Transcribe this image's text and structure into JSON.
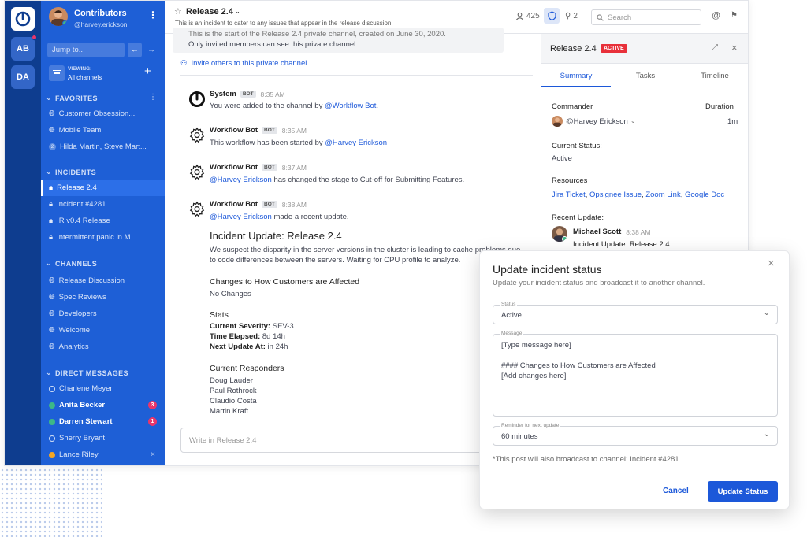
{
  "teams": {
    "items": [
      {
        "initials": "AB"
      },
      {
        "initials": "DA"
      }
    ]
  },
  "sidebar": {
    "team_name": "Contributors",
    "username": "@harvey.erickson",
    "jump_placeholder": "Jump to...",
    "viewing_label": "VIEWING:",
    "viewing_value": "All channels",
    "favorites_header": "FAVORITES",
    "favorites": [
      {
        "label": "Customer Obsession..."
      },
      {
        "label": "Mobile Team"
      },
      {
        "label": "Hilda Martin, Steve Mart...",
        "count": "2"
      }
    ],
    "incidents_header": "INCIDENTS",
    "incidents": [
      {
        "label": "Release 2.4"
      },
      {
        "label": "Incident #4281"
      },
      {
        "label": "IR v0.4 Release"
      },
      {
        "label": "Intermittent panic in M..."
      }
    ],
    "channels_header": "CHANNELS",
    "channels": [
      {
        "label": "Release Discussion"
      },
      {
        "label": "Spec Reviews"
      },
      {
        "label": "Developers"
      },
      {
        "label": "Welcome"
      },
      {
        "label": "Analytics"
      }
    ],
    "dm_header": "DIRECT MESSAGES",
    "dms": [
      {
        "label": "Charlene Meyer"
      },
      {
        "label": "Anita Becker",
        "badge": "3"
      },
      {
        "label": "Darren Stewart",
        "badge": "1"
      },
      {
        "label": "Sherry Bryant"
      },
      {
        "label": "Lance Riley"
      }
    ]
  },
  "header": {
    "channel_name": "Release 2.4",
    "purpose": "This is an incident to cater to any issues that appear in the release discussion",
    "member_count": "425",
    "pinned_count": "2",
    "search_placeholder": "Search"
  },
  "messages": {
    "top_text_1": "This is the start of the Release 2.4 private channel, created on June 30, 2020.",
    "top_text_2": "Only invited members can see this private channel.",
    "invite_link": "Invite others to this private channel",
    "bot_tag": "BOT",
    "m1": {
      "author": "System",
      "time": "8:35 AM",
      "text_pre": "You were added to the channel by ",
      "mention": "@Workflow Bot",
      "text_post": "."
    },
    "m2": {
      "author": "Workflow Bot",
      "time": "8:35 AM",
      "text_pre": "This workflow has been started by ",
      "mention": "@Harvey Erickson"
    },
    "m3": {
      "author": "Workflow Bot",
      "time": "8:37 AM",
      "mention": "@Harvey Erickson",
      "text_post": " has changed the stage to Cut-off for Submitting Features."
    },
    "m4": {
      "author": "Workflow Bot",
      "time": "8:38 AM",
      "mention": "@Harvey Erickson",
      "text_post": " made a recent update."
    },
    "update_title": "Incident Update: Release 2.4",
    "update_body": "We suspect the disparity in the server versions in the cluster is leading to cache problems due to code differences between the servers. Waiting for CPU profile to analyze.",
    "changes_title": "Changes to How Customers are Affected",
    "changes_body": "No Changes",
    "stats_title": "Stats",
    "severity_label": "Current Severity:",
    "severity_value": " SEV-3",
    "elapsed_label": "Time Elapsed:",
    "elapsed_value": " 8d 14h",
    "next_label": "Next Update At:",
    "next_value": " in 24h",
    "responders_title": "Current Responders",
    "responders": [
      "Doug Lauder",
      "Paul Rothrock",
      "Claudio Costa",
      "Martin Kraft"
    ],
    "input_placeholder": "Write in Release 2.4"
  },
  "rhs": {
    "title": "Release 2.4",
    "status_badge": "ACTIVE",
    "tabs": [
      "Summary",
      "Tasks",
      "Timeline"
    ],
    "commander_label": "Commander",
    "commander_value": "@Harvey Erickson",
    "duration_label": "Duration",
    "duration_value": "1m",
    "status_label": "Current Status:",
    "status_value": "Active",
    "resources_label": "Resources",
    "resources": [
      "Jira Ticket",
      "Opsignee Issue",
      "Zoom Link",
      "Google Doc"
    ],
    "recent_label": "Recent Update:",
    "recent_author": "Michael Scott",
    "recent_time": "8:38 AM",
    "recent_text": "Incident Update: Release 2.4"
  },
  "modal": {
    "title": "Update incident status",
    "subtitle": "Update your incident status and broadcast it to another channel.",
    "status_label": "Status",
    "status_value": "Active",
    "message_label": "Message",
    "message_line1": "[Type message here]",
    "message_line2": "#### Changes to How Customers are Affected",
    "message_line3": "[Add changes here]",
    "reminder_label": "Reminder for next update",
    "reminder_value": "60 minutes",
    "note": "*This post will also broadcast to channel: Incident #4281",
    "cancel": "Cancel",
    "submit": "Update Status"
  },
  "colors": {
    "sidebar": "#1e5fd6",
    "team_sidebar": "#0e3d8f",
    "accent": "#1c58d9",
    "active_badge": "#e8366b",
    "online": "#3db887",
    "away": "#f5a623"
  }
}
